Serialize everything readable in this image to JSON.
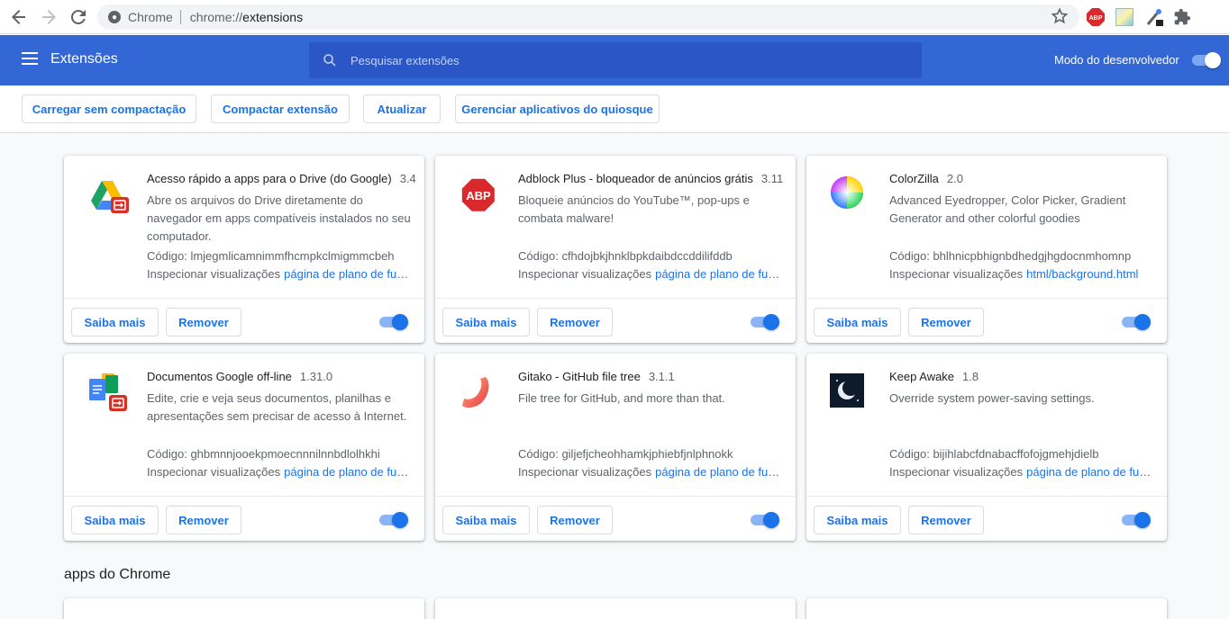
{
  "browser": {
    "site_chip": "Chrome",
    "url_scheme": "chrome://",
    "url_path": "extensions",
    "extension_icons": [
      "adblock-plus",
      "color-image",
      "wrench-pen",
      "puzzle"
    ]
  },
  "header": {
    "title": "Extensões",
    "search_placeholder": "Pesquisar extensões",
    "dev_mode_label": "Modo do desenvolvedor",
    "dev_mode_enabled": true,
    "color": "#3367d6"
  },
  "actions": {
    "load_unpacked": "Carregar sem compactação",
    "pack": "Compactar extensão",
    "update": "Atualizar",
    "kiosk": "Gerenciar aplicativos do quiosque"
  },
  "card_labels": {
    "more": "Saiba mais",
    "remove": "Remover",
    "code_prefix": "Código:",
    "inspect_prefix": "Inspecionar visualizações"
  },
  "extensions": [
    {
      "name": "Acesso rápido a apps para o Drive (do Google)",
      "version": "3.4",
      "description": "Abre os arquivos do Drive diretamente do navegador em apps compatíveis instalados no seu computador.",
      "id": "lmjegmlicamnimmfhcmpkclmigmmcbeh",
      "inspect_link": "página de plano de fundo",
      "icon": "drive-app-icon",
      "enabled": true
    },
    {
      "name": "Adblock Plus - bloqueador de anúncios grátis",
      "version": "3.11",
      "description": "Bloqueie anúncios do YouTube™, pop-ups e combata malware!",
      "id": "cfhdojbkjhnklbpkdaibdccddilifddb",
      "inspect_link": "página de plano de fundo",
      "icon": "adblock-plus-icon",
      "enabled": true
    },
    {
      "name": "ColorZilla",
      "version": "2.0",
      "description": "Advanced Eyedropper, Color Picker, Gradient Generator and other colorful goodies",
      "id": "bhlhnicpbhignbdhedgjhgdocnmhomnp",
      "inspect_link": "html/background.html",
      "icon": "colorzilla-icon",
      "enabled": true
    },
    {
      "name": "Documentos Google off-line",
      "version": "1.31.0",
      "description": "Edite, crie e veja seus documentos, planilhas e apresentações sem precisar de acesso à Internet.",
      "id": "ghbmnnjooekpmoecnnnilnnbdlolhkhi",
      "inspect_link": "página de plano de fundo",
      "icon": "google-docs-offline-icon",
      "enabled": true
    },
    {
      "name": "Gitako - GitHub file tree",
      "version": "3.1.1",
      "description": "File tree for GitHub, and more than that.",
      "id": "giljefjcheohhamkjphiebfjnlphnokk",
      "inspect_link": "página de plano de fundo",
      "icon": "gitako-icon",
      "enabled": true
    },
    {
      "name": "Keep Awake",
      "version": "1.8",
      "description": "Override system power-saving settings.",
      "id": "bijihlabcfdnabacffofojgmehjdielb",
      "inspect_link": "página de plano de fundo",
      "icon": "keep-awake-moon-icon",
      "enabled": true
    }
  ],
  "apps_section_title": "apps do Chrome"
}
